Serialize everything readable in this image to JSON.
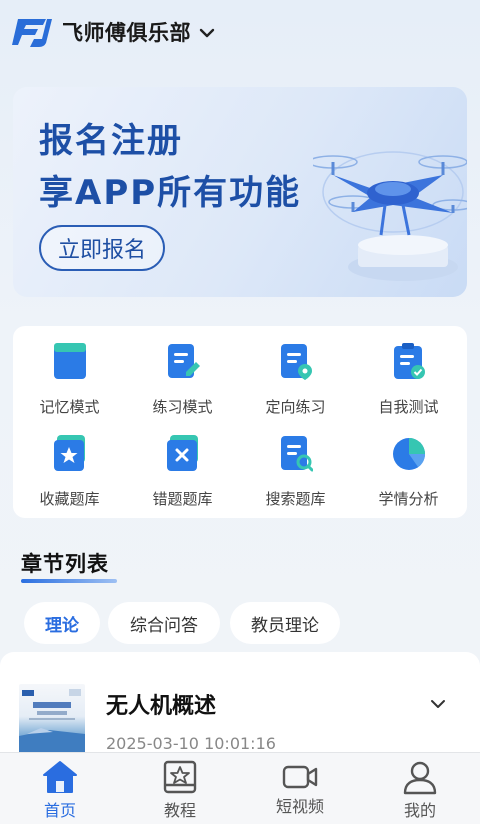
{
  "header": {
    "club_name": "飞师傅俱乐部",
    "logo_icon": "fj-logo-icon",
    "dropdown_icon": "chevron-down-icon"
  },
  "banner": {
    "line1": "报名注册",
    "line2": "享APP所有功能",
    "button_label": "立即报名",
    "accent": "#1d4fa6"
  },
  "functions": [
    {
      "label": "记忆模式",
      "icon": "book-icon"
    },
    {
      "label": "练习模式",
      "icon": "edit-doc-icon"
    },
    {
      "label": "定向练习",
      "icon": "target-doc-icon"
    },
    {
      "label": "自我测试",
      "icon": "clipboard-check-icon"
    },
    {
      "label": "收藏题库",
      "icon": "star-bank-icon"
    },
    {
      "label": "错题题库",
      "icon": "wrong-bank-icon"
    },
    {
      "label": "搜索题库",
      "icon": "search-doc-icon"
    },
    {
      "label": "学情分析",
      "icon": "pie-chart-icon"
    }
  ],
  "section": {
    "title": "章节列表"
  },
  "tabs": [
    {
      "label": "理论",
      "active": true
    },
    {
      "label": "综合问答",
      "active": false
    },
    {
      "label": "教员理论",
      "active": false
    }
  ],
  "chapter": {
    "title": "无人机概述",
    "date": "2025-03-10 10:01:16",
    "thumb_title": "无人机驾驶员",
    "thumb_subtitle": "理论知识手册"
  },
  "bottom_nav": [
    {
      "label": "首页",
      "icon": "home-icon",
      "active": true
    },
    {
      "label": "教程",
      "icon": "tutorial-icon",
      "active": false
    },
    {
      "label": "短视频",
      "icon": "video-icon",
      "active": false
    },
    {
      "label": "我的",
      "icon": "profile-icon",
      "active": false
    }
  ],
  "colors": {
    "primary": "#2a6de0",
    "icon_blue": "#2b7be6",
    "icon_teal": "#36c6b2"
  }
}
